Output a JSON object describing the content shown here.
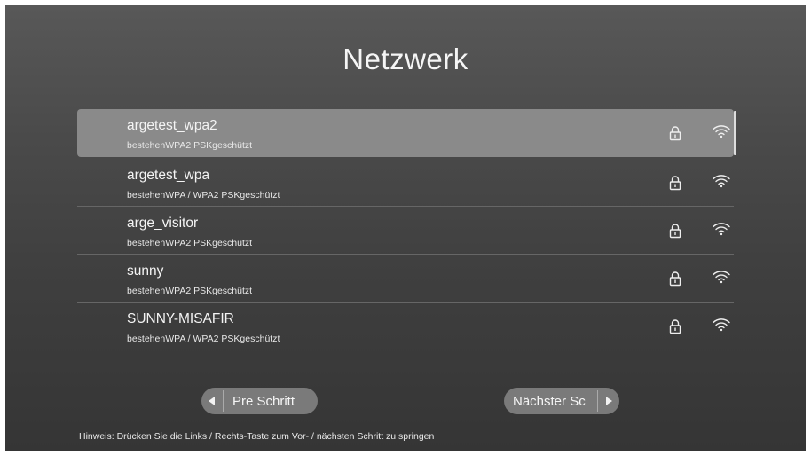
{
  "header": {
    "title": "Netzwerk"
  },
  "networks": [
    {
      "ssid": "argetest_wpa2",
      "security": "bestehenWPA2 PSKgeschützt",
      "locked": true,
      "selected": true
    },
    {
      "ssid": "argetest_wpa",
      "security": "bestehenWPA / WPA2 PSKgeschützt",
      "locked": true,
      "selected": false
    },
    {
      "ssid": "arge_visitor",
      "security": "bestehenWPA2 PSKgeschützt",
      "locked": true,
      "selected": false
    },
    {
      "ssid": "sunny",
      "security": "bestehenWPA2 PSKgeschützt",
      "locked": true,
      "selected": false
    },
    {
      "ssid": "SUNNY-MISAFIR",
      "security": "bestehenWPA / WPA2 PSKgeschützt",
      "locked": true,
      "selected": false
    }
  ],
  "nav": {
    "prev_label": "Pre Schritt",
    "next_label": "Nächster Sc"
  },
  "hint": "Hinweis: Drücken Sie die Links / Rechts-Taste zum Vor- / nächsten Schritt zu springen",
  "icons": {
    "lock": "lock-icon",
    "wifi": "wifi-signal-icon",
    "left": "triangle-left-icon",
    "right": "triangle-right-icon"
  },
  "colors": {
    "selected_row": "#8a8a8a",
    "button_bg": "#7a7a7a"
  }
}
